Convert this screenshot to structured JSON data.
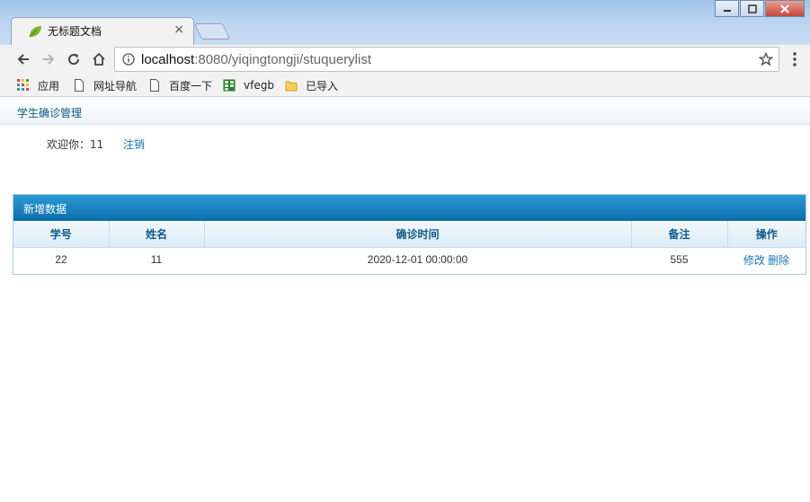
{
  "browser": {
    "tab_title": "无标题文档",
    "tab_close": "×",
    "url_host": "localhost",
    "url_port": ":8080",
    "url_path": "/yiqingtongji/stuquerylist",
    "bookmarks": [
      {
        "label": "应用",
        "icon": "apps-grid-icon"
      },
      {
        "label": "网址导航",
        "icon": "page-icon"
      },
      {
        "label": "百度一下",
        "icon": "page-icon"
      },
      {
        "label": "vfegb",
        "icon": "sheet-icon"
      },
      {
        "label": "已导入",
        "icon": "folder-icon"
      }
    ]
  },
  "header": {
    "title": "学生确诊管理"
  },
  "user": {
    "welcome": "欢迎你：11",
    "logout": "注销"
  },
  "panel": {
    "add_label": "新增数据"
  },
  "table": {
    "columns": [
      "学号",
      "姓名",
      "确诊时间",
      "备注",
      "操作"
    ],
    "rows": [
      {
        "id": "22",
        "name": "11",
        "time": "2020-12-01 00:00:00",
        "note": "555",
        "edit": "修改",
        "delete": "删除"
      }
    ]
  },
  "colors": {
    "accent": "#1a75b8",
    "panel_head": "#0c6eaa",
    "header_text": "#0e5a8a"
  }
}
